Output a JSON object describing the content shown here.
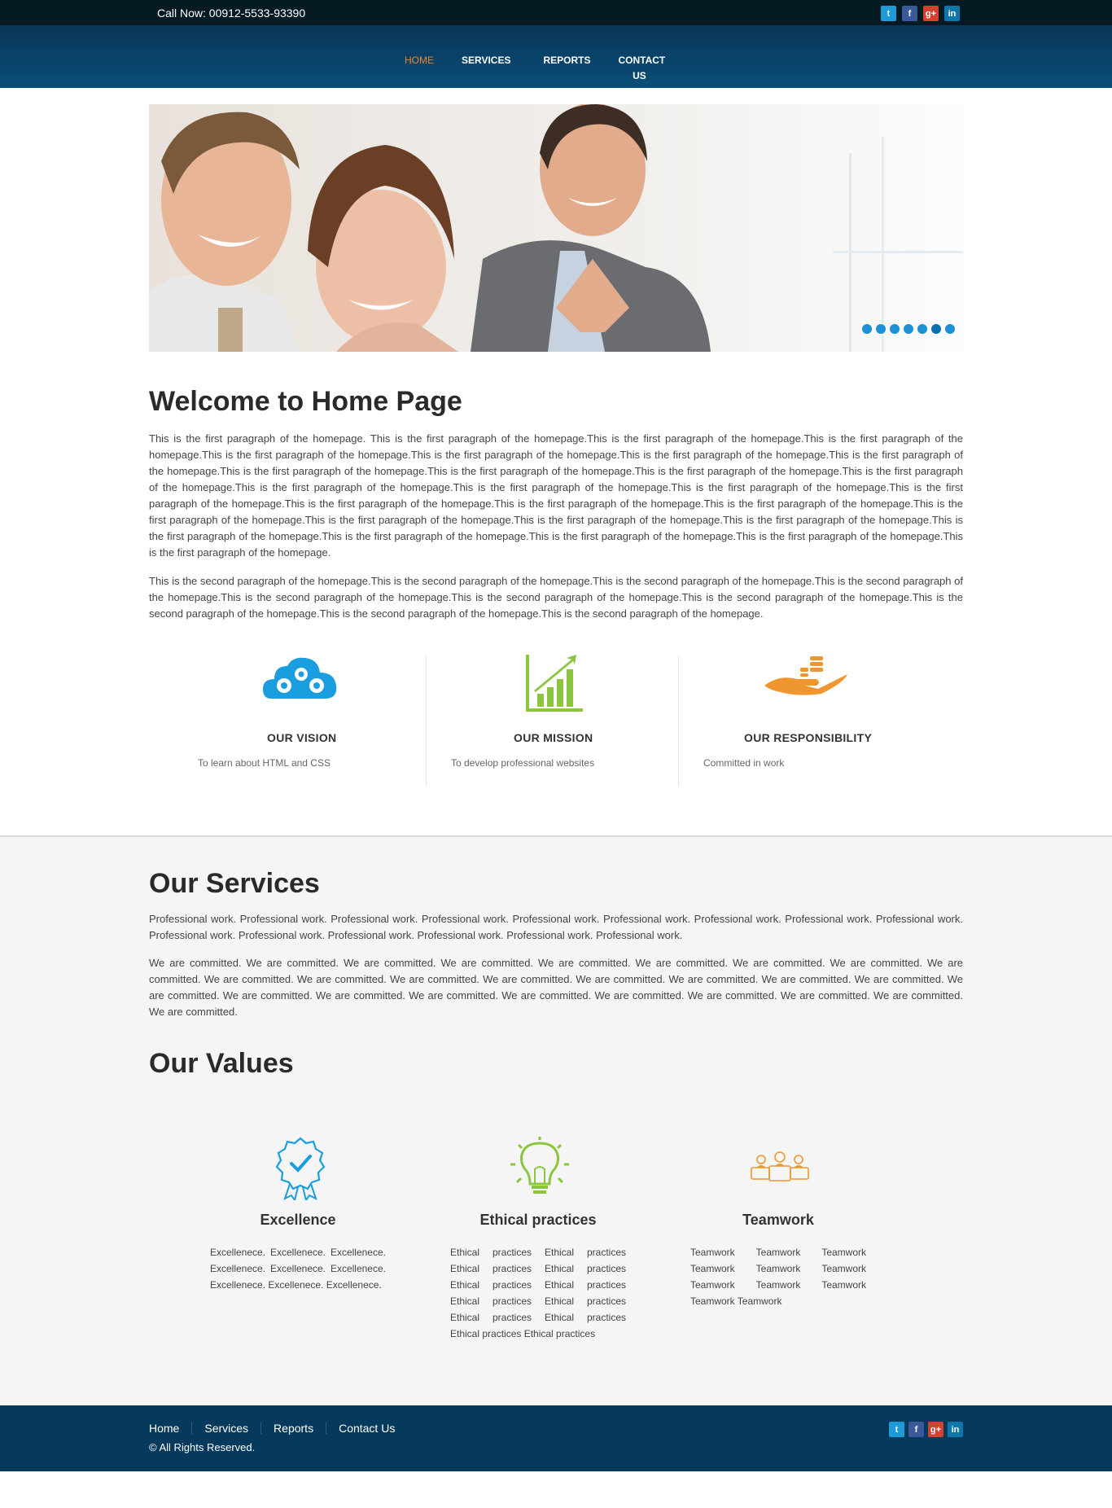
{
  "topbar": {
    "call_now": "Call Now: 00912-5533-93390",
    "social": [
      {
        "name": "twitter-icon",
        "glyph": "t"
      },
      {
        "name": "facebook-icon",
        "glyph": "f"
      },
      {
        "name": "googleplus-icon",
        "glyph": "g+"
      },
      {
        "name": "linkedin-icon",
        "glyph": "in"
      }
    ]
  },
  "nav": {
    "items": [
      {
        "label": "HOME",
        "active": true
      },
      {
        "label": "SERVICES",
        "active": false
      },
      {
        "label": "REPORTS",
        "active": false
      },
      {
        "label": "CONTACT US",
        "active": false
      }
    ]
  },
  "slider": {
    "dots": 7,
    "active_dot": 6
  },
  "welcome": {
    "title": "Welcome to Home Page",
    "paragraph1": "This is the first paragraph of the homepage. This is the first paragraph of the homepage.This is the first paragraph of the homepage.This is the first paragraph of the homepage.This is the first paragraph of the homepage.This is the first paragraph of the homepage.This is the first paragraph of the homepage.This is the first paragraph of the homepage.This is the first paragraph of the homepage.This is the first paragraph of the homepage.This is the first paragraph of the homepage.This is the first paragraph of the homepage.This is the first paragraph of the homepage.This is the first paragraph of the homepage.This is the first paragraph of the homepage.This is the first paragraph of the homepage.This is the first paragraph of the homepage.This is the first paragraph of the homepage.This is the first paragraph of the homepage.This is the first paragraph of the homepage.This is the first paragraph of the homepage.This is the first paragraph of the homepage.This is the first paragraph of the homepage.This is the first paragraph of the homepage.This is the first paragraph of the homepage.This is the first paragraph of the homepage.This is the first paragraph of the homepage.This is the first paragraph of the homepage.",
    "paragraph2": "This is the second paragraph of the homepage.This is the second paragraph of the homepage.This is the second paragraph of the homepage.This is the second paragraph of the homepage.This is the second paragraph of the homepage.This is the second paragraph of the homepage.This is the second paragraph of the homepage.This is the second paragraph of the homepage.This is the second paragraph of the homepage.This is the second paragraph of the homepage."
  },
  "features": [
    {
      "title": "OUR VISION",
      "text": "To learn about HTML and CSS",
      "icon": "cloud-gears-icon",
      "color": "#1a9ee0"
    },
    {
      "title": "OUR MISSION",
      "text": "To develop professional websites",
      "icon": "growth-chart-icon",
      "color": "#8cc63f"
    },
    {
      "title": "OUR RESPONSIBILITY",
      "text": "Committed in work",
      "icon": "hand-coins-icon",
      "color": "#f0962e"
    }
  ],
  "services": {
    "title": "Our Services",
    "paragraph1": "Professional work. Professional work. Professional work. Professional work. Professional work. Professional work. Professional work. Professional work. Professional work. Professional work. Professional work. Professional work. Professional work. Professional work. Professional work.",
    "paragraph2": "We are committed. We are committed. We are committed. We are committed. We are committed. We are committed. We are committed. We are committed. We are committed. We are committed. We are committed. We are committed. We are committed. We are committed. We are committed. We are committed. We are committed. We are committed. We are committed. We are committed. We are committed. We are committed. We are committed. We are committed. We are committed. We are committed. We are committed."
  },
  "values": {
    "title": "Our Values",
    "items": [
      {
        "title": "Excellence",
        "text": "Excellenece. Excellenece. Excellenece. Excellenece. Excellenece. Excellenece. Excellenece. Excellenece. Excellenece.",
        "icon": "award-badge-icon",
        "color": "#1a9ee0"
      },
      {
        "title": "Ethical practices",
        "text": "Ethical practices Ethical practices Ethical practices Ethical practices Ethical practices Ethical practices Ethical practices Ethical practices Ethical practices Ethical practices Ethical practices Ethical practices",
        "icon": "lightbulb-icon",
        "color": "#8cc63f"
      },
      {
        "title": "Teamwork",
        "text": "Teamwork Teamwork Teamwork Teamwork Teamwork Teamwork Teamwork Teamwork Teamwork Teamwork Teamwork",
        "icon": "team-icon",
        "color": "#f0962e"
      }
    ]
  },
  "footer": {
    "links": [
      "Home",
      "Services",
      "Reports",
      "Contact Us"
    ],
    "copyright": "© All Rights Reserved."
  },
  "colors": {
    "topbar": "#061a24",
    "nav": "#0a4e7a",
    "nav_active": "#f0862a",
    "footer": "#063a5c",
    "section_bg": "#f5f5f5"
  }
}
